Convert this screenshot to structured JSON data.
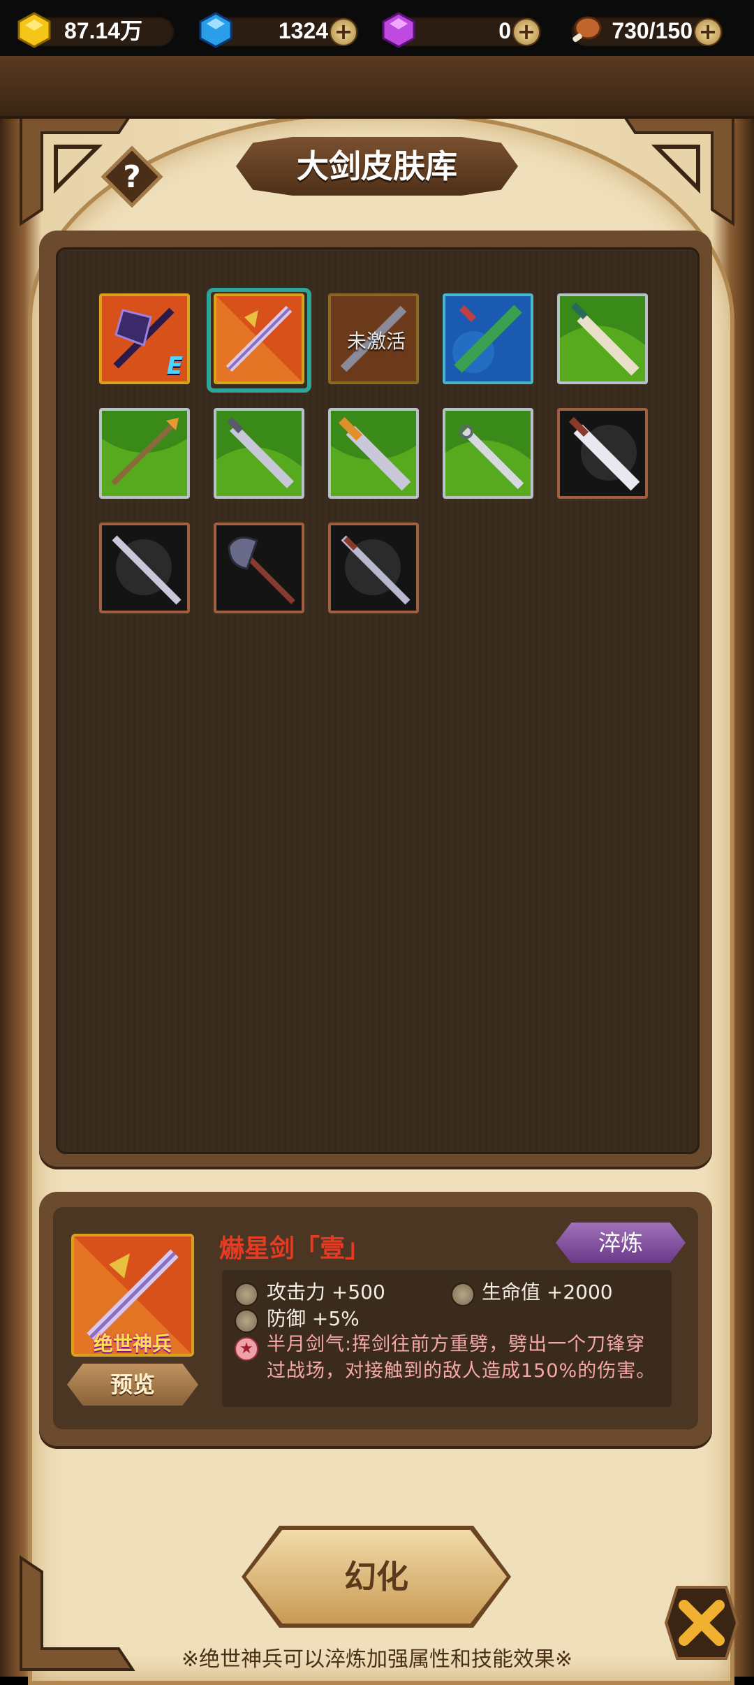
{
  "resources": {
    "gold": "87.14万",
    "gems": "1324",
    "crystals": "0",
    "stamina": "730/150"
  },
  "title": "大剑皮肤库",
  "grid": {
    "unactivated_label": "未激活",
    "badge_label": "E"
  },
  "detail": {
    "skin_name": "爀星剑「壹」",
    "rarity_label": "绝世神兵",
    "preview_label": "预览",
    "refine_label": "淬炼",
    "stats": [
      "攻击力 +500",
      "生命值 +2000",
      "防御 +5%"
    ],
    "skill": "半月剑气:挥剑往前方重劈，劈出一个刀锋穿过战场，对接触到的敌人造成150%的伤害。"
  },
  "transform_label": "幻化",
  "footnote": "※绝世神兵可以淬炼加强属性和技能效果※"
}
